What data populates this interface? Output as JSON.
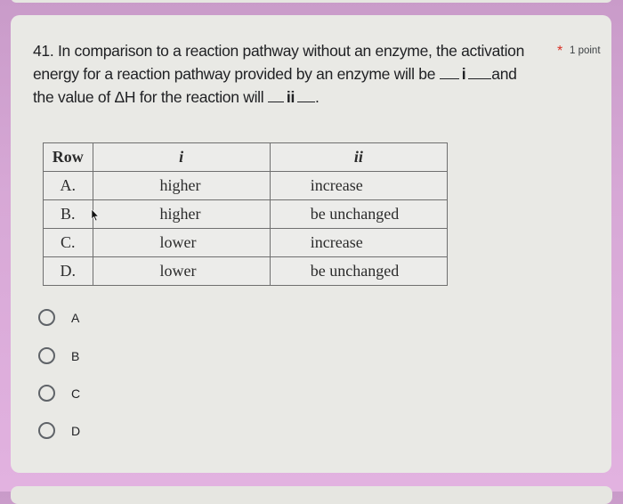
{
  "question": {
    "number": "41.",
    "line1": "In comparison to a reaction pathway without an enzyme, the activation",
    "line2_pre": "energy for a reaction pathway provided by an enzyme will be",
    "blank_i": "i",
    "line2_post": "and",
    "line3_pre": "the value of ΔH for the reaction will",
    "blank_ii": "ii",
    "line3_post": ".",
    "required_marker": "*",
    "points": "1 point"
  },
  "table": {
    "headers": [
      "Row",
      "i",
      "ii"
    ],
    "rows": [
      {
        "row": "A.",
        "i": "higher",
        "ii": "increase"
      },
      {
        "row": "B.",
        "i": "higher",
        "ii": "be unchanged"
      },
      {
        "row": "C.",
        "i": "lower",
        "ii": "increase"
      },
      {
        "row": "D.",
        "i": "lower",
        "ii": "be unchanged"
      }
    ]
  },
  "options": [
    {
      "label": "A",
      "selected": false
    },
    {
      "label": "B",
      "selected": false
    },
    {
      "label": "C",
      "selected": false
    },
    {
      "label": "D",
      "selected": false
    }
  ],
  "colors": {
    "background": "#d7a8d6",
    "card": "#e9e9e5",
    "required": "#d93025",
    "radio_border": "#5f6368"
  }
}
